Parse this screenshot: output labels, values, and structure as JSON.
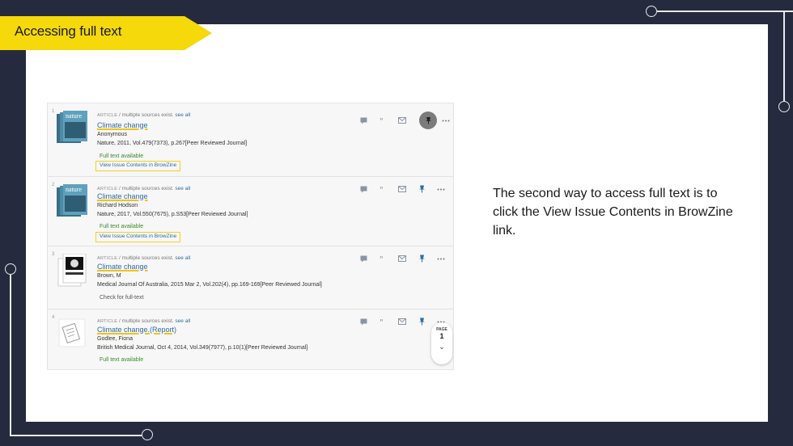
{
  "slide": {
    "title": "Accessing full text",
    "explanation": "The second way to access full text is to click the View Issue Contents in BrowZine link."
  },
  "results": [
    {
      "number": "1",
      "type": "ARTICLE",
      "sources_text": "/ multiple sources exist.",
      "see_all": "see all",
      "title": "Climate change",
      "author": "Anonymous",
      "citation": "Nature, 2011, Vol.479(7373), p.267[Peer Reviewed Journal]",
      "availability": "Full text available",
      "browzine_link": "View Issue Contents in BrowZine"
    },
    {
      "number": "2",
      "type": "ARTICLE",
      "sources_text": "/ multiple sources exist.",
      "see_all": "see all",
      "title": "Climate change",
      "author": "Richard Hodson",
      "citation": "Nature, 2017, Vol.550(7675), p.S53[Peer Reviewed Journal]",
      "availability": "Full text available",
      "browzine_link": "View Issue Contents in BrowZine"
    },
    {
      "number": "3",
      "type": "ARTICLE",
      "sources_text": "/ multiple sources exist.",
      "see_all": "see all",
      "title": "Climate change",
      "author": "Brown, M",
      "citation": "Medical Journal Of Australia, 2015 Mar 2, Vol.202(4), pp.169-169[Peer Reviewed Journal]",
      "availability": "Check for full-text"
    },
    {
      "number": "4",
      "type": "ARTICLE",
      "sources_text": "/ multiple sources exist.",
      "see_all": "see all",
      "title": "Climate change.(Report)",
      "author": "Godlee, Fiona",
      "citation": "British Medical Journal, Oct 4, 2014, Vol.349(7977), p.10(1)[Peer Reviewed Journal]",
      "availability": "Full text available"
    }
  ],
  "pager": {
    "label": "PAGE",
    "number": "1",
    "down": "⌄"
  },
  "colors": {
    "frame": "#262a3f",
    "banner": "#f5d90a",
    "link": "#2d6ca2",
    "highlight": "#f2d21b",
    "available": "#3b8a2e"
  }
}
